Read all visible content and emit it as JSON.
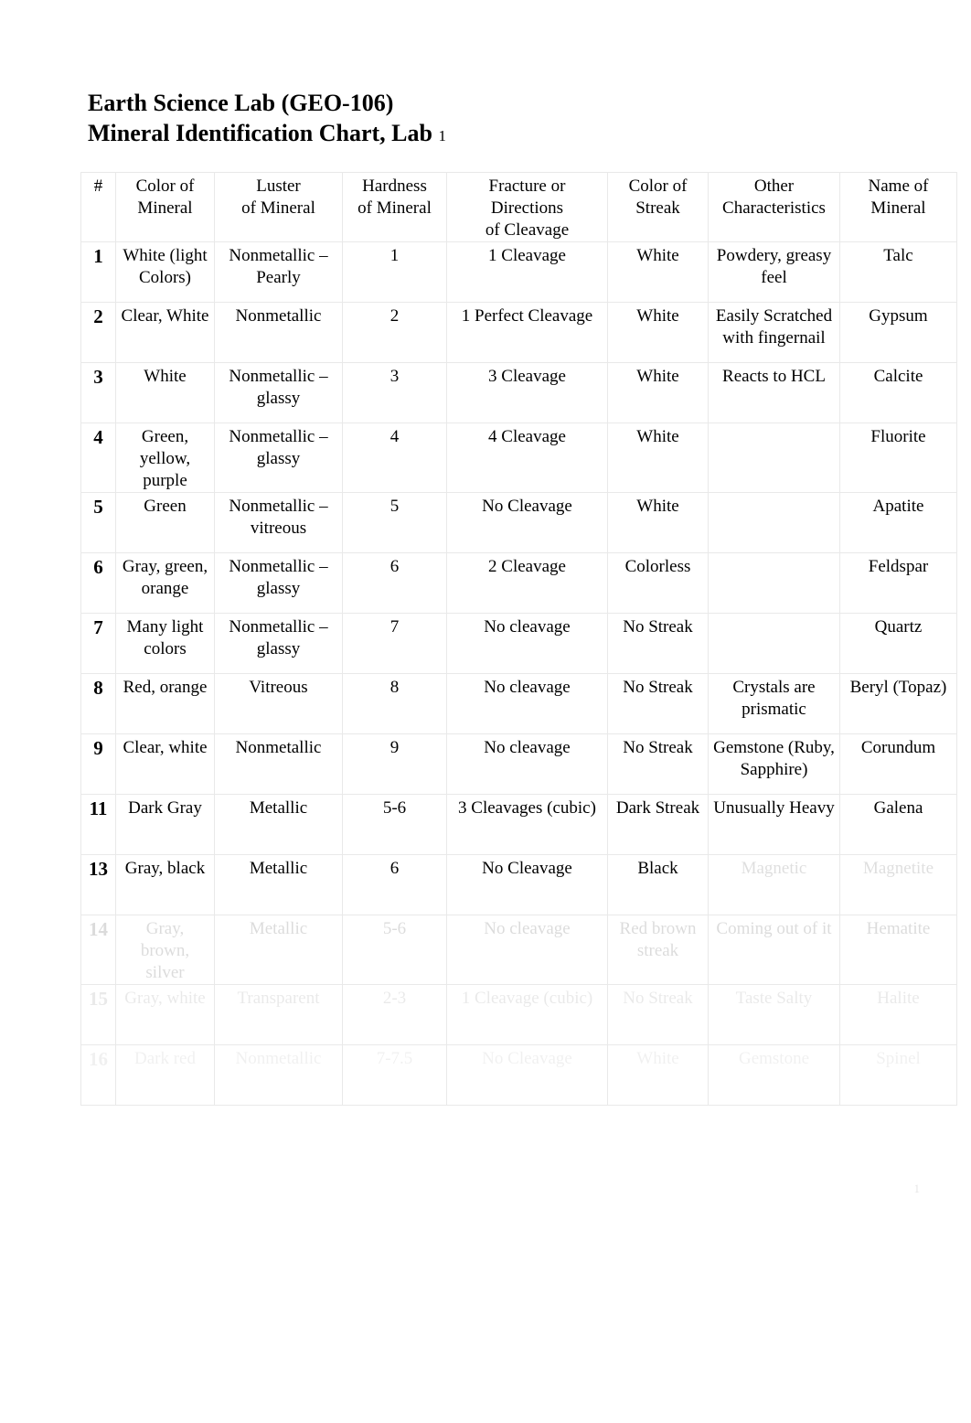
{
  "document": {
    "title_line1": "Earth Science Lab (GEO-106)",
    "title_line2_main": "Mineral Identification Chart, Lab",
    "title_line2_sub": "1",
    "page_marker": "1"
  },
  "table": {
    "headers": [
      {
        "line1": "#",
        "line2": "",
        "line3": ""
      },
      {
        "line1": "Color of",
        "line2": "Mineral",
        "line3": ""
      },
      {
        "line1": "Luster",
        "line2": "of Mineral",
        "line3": ""
      },
      {
        "line1": "Hardness",
        "line2": "of Mineral",
        "line3": ""
      },
      {
        "line1": "Fracture",
        "line1_lite": " or",
        "line2": "Directions",
        "line3": "of Cleavage"
      },
      {
        "line1": "Color of",
        "line2": "Streak",
        "line3": ""
      },
      {
        "line1": "Other",
        "line2": "Characteristics",
        "line3": ""
      },
      {
        "line1": "Name of",
        "line2": "Mineral",
        "line3": ""
      }
    ],
    "rows": [
      {
        "num": "1",
        "color": "White (light Colors)",
        "luster": "Nonmetallic – Pearly",
        "hardness": "1",
        "fracture": "1 Cleavage",
        "streak": "White",
        "other": "Powdery, greasy feel",
        "name": "Talc"
      },
      {
        "num": "2",
        "color": "Clear, White",
        "luster": "Nonmetallic",
        "hardness": "2",
        "fracture": "1 Perfect Cleavage",
        "streak": "White",
        "other": "Easily Scratched with fingernail",
        "name": "Gypsum"
      },
      {
        "num": "3",
        "color": "White",
        "luster": "Nonmetallic – glassy",
        "hardness": "3",
        "fracture": "3 Cleavage",
        "streak": "White",
        "other": "Reacts to HCL",
        "name": "Calcite"
      },
      {
        "num": "4",
        "color": "Green, yellow, purple",
        "luster": "Nonmetallic – glassy",
        "hardness": "4",
        "fracture": "4 Cleavage",
        "streak": "White",
        "other": "",
        "name": "Fluorite"
      },
      {
        "num": "5",
        "color": "Green",
        "luster": "Nonmetallic – vitreous",
        "hardness": "5",
        "fracture": "No Cleavage",
        "streak": "White",
        "other": "",
        "name": "Apatite"
      },
      {
        "num": "6",
        "color": "Gray, green, orange",
        "luster": "Nonmetallic – glassy",
        "hardness": "6",
        "fracture": "2 Cleavage",
        "streak": "Colorless",
        "other": "",
        "name": "Feldspar"
      },
      {
        "num": "7",
        "color": "Many light colors",
        "luster": "Nonmetallic – glassy",
        "hardness": "7",
        "fracture": "No cleavage",
        "streak": "No Streak",
        "other": "",
        "name": "Quartz"
      },
      {
        "num": "8",
        "color": "Red, orange",
        "luster": "Vitreous",
        "hardness": "8",
        "fracture": "No cleavage",
        "streak": "No Streak",
        "other": "Crystals are prismatic",
        "name": "Beryl (Topaz)"
      },
      {
        "num": "9",
        "color": "Clear, white",
        "luster": "Nonmetallic",
        "hardness": "9",
        "fracture": "No cleavage",
        "streak": "No Streak",
        "other": "Gemstone (Ruby, Sapphire)",
        "name": "Corundum"
      },
      {
        "num": "11",
        "color": "Dark Gray",
        "luster": "Metallic",
        "hardness": "5-6",
        "fracture": "3 Cleavages (cubic)",
        "streak": "Dark Streak",
        "other": "Unusually Heavy",
        "name": "Galena"
      },
      {
        "num": "13",
        "color": "Gray, black",
        "luster": "Metallic",
        "hardness": "6",
        "fracture": "No Cleavage",
        "streak": "Black",
        "other": "Magnetic",
        "name": "Magnetite"
      },
      {
        "num": "14",
        "color": "Gray, brown, silver",
        "luster": "Metallic",
        "hardness": "5-6",
        "fracture": "No cleavage",
        "streak": "Red brown streak",
        "other": "Coming out of it",
        "name": "Hematite"
      },
      {
        "num": "15",
        "color": "Gray, white",
        "luster": "Transparent",
        "hardness": "2-3",
        "fracture": "1 Cleavage (cubic)",
        "streak": "No Streak",
        "other": "Taste Salty",
        "name": "Halite"
      },
      {
        "num": "16",
        "color": "Dark red",
        "luster": "Nonmetallic",
        "hardness": "7-7.5",
        "fracture": "No Cleavage",
        "streak": "White",
        "other": "Gemstone",
        "name": "Spinel"
      }
    ]
  }
}
